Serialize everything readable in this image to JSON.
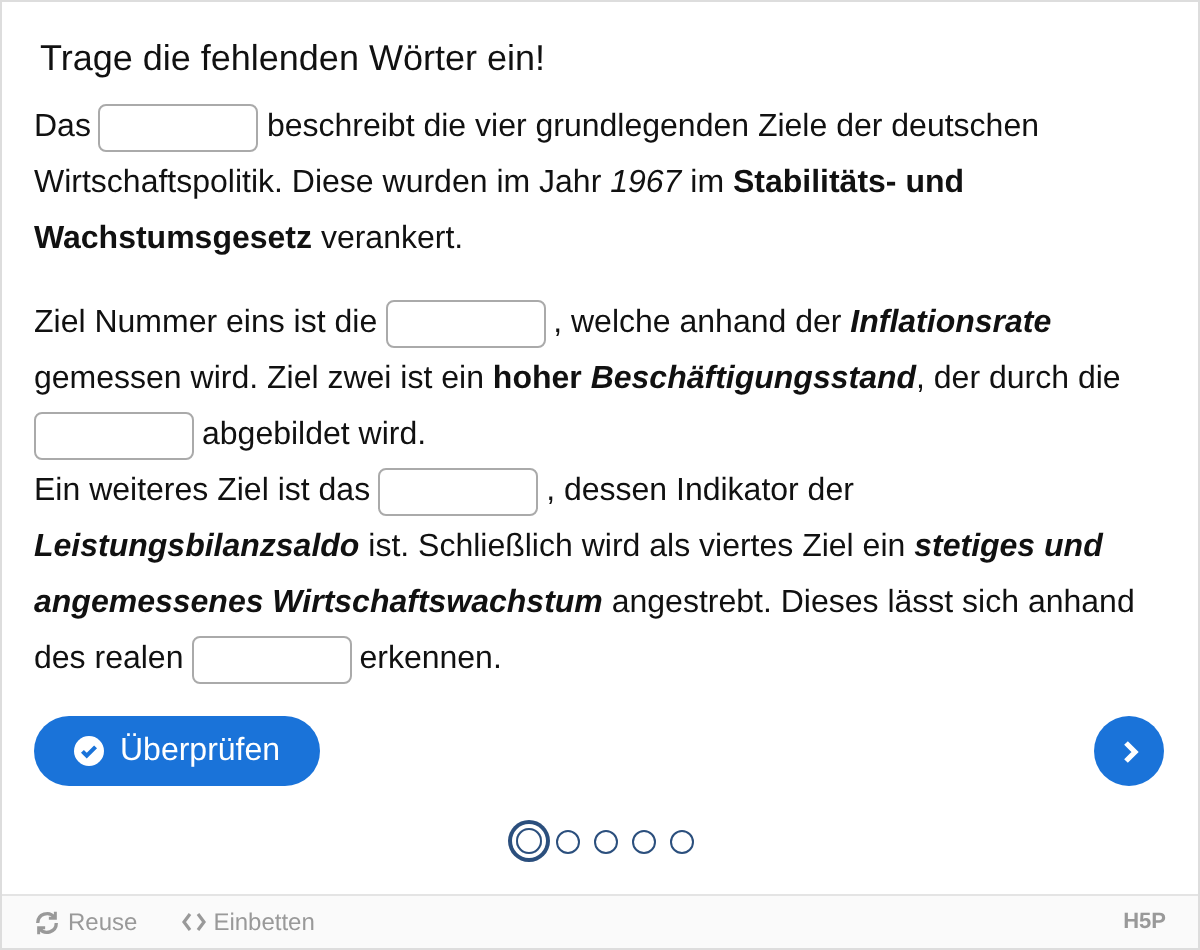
{
  "task": {
    "title": "Trage die fehlenden Wörter ein!"
  },
  "paragraphs": [
    {
      "lines": [
        [
          {
            "kind": "text",
            "text": "Das"
          },
          {
            "kind": "blank"
          },
          {
            "kind": "text",
            "text": "beschreibt die vier grundlegenden Ziele der deutschen"
          }
        ],
        [
          {
            "kind": "text",
            "text": "Wirtschaftspolitik. Diese wurden im Jahr *1967* im **Stabilitäts- und**"
          }
        ],
        [
          {
            "kind": "text",
            "text": "**Wachstumsgesetz** verankert."
          }
        ]
      ]
    },
    {
      "lines": [
        [
          {
            "kind": "text",
            "text": "Ziel Nummer eins ist die"
          },
          {
            "kind": "blank"
          },
          {
            "kind": "text",
            "text": ", welche anhand der "
          },
          {
            "kind": "term",
            "text": "Inflationsrate"
          }
        ],
        [
          {
            "kind": "text",
            "text": "gemessen wird. Ziel zwei ist ein **hoher** "
          },
          {
            "kind": "term",
            "text": "Beschäftigungsstand"
          },
          {
            "kind": "text",
            "text": ", der durch die"
          }
        ],
        [
          {
            "kind": "blank"
          },
          {
            "kind": "text",
            "text": "abgebildet wird."
          }
        ],
        [
          {
            "kind": "text",
            "text": "Ein weiteres Ziel ist das"
          },
          {
            "kind": "blank"
          },
          {
            "kind": "text",
            "text": ", dessen Indikator der"
          }
        ],
        [
          {
            "kind": "term",
            "text": "Leistungsbilanzsaldo"
          },
          {
            "kind": "text",
            "text": " ist. Schließlich wird als viertes Ziel ein "
          },
          {
            "kind": "term",
            "text": "stetiges und"
          }
        ],
        [
          {
            "kind": "term",
            "text": "angemessenes Wirtschaftswachstum"
          },
          {
            "kind": "text",
            "text": " angestrebt. Dieses lässt sich anhand"
          }
        ],
        [
          {
            "kind": "text",
            "text": "des realen"
          },
          {
            "kind": "blank"
          },
          {
            "kind": "text",
            "text": "erkennen."
          }
        ]
      ]
    }
  ],
  "check_button": "Überprüfen",
  "slides": [
    {
      "selected": true
    },
    {
      "selected": false
    },
    {
      "selected": false
    },
    {
      "selected": false
    },
    {
      "selected": false
    }
  ],
  "footer": {
    "reuse": "Reuse",
    "embed": "Einbetten",
    "logo": "H5P"
  }
}
